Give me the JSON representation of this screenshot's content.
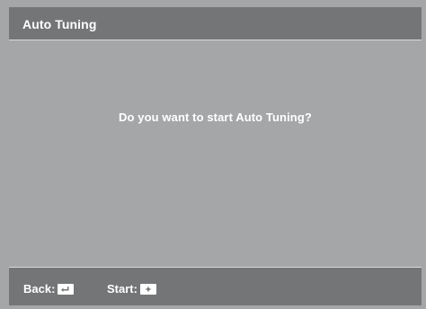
{
  "window": {
    "title": "Auto Tuning"
  },
  "dialog": {
    "message": "Do you want to start Auto Tuning?"
  },
  "footer": {
    "back_label": "Back:",
    "back_icon": "return-arrow-icon",
    "start_label": "Start:",
    "start_icon": "enter-button-icon"
  },
  "colors": {
    "background": "#a5a6a8",
    "bar": "#747577",
    "text": "#ffffff"
  }
}
